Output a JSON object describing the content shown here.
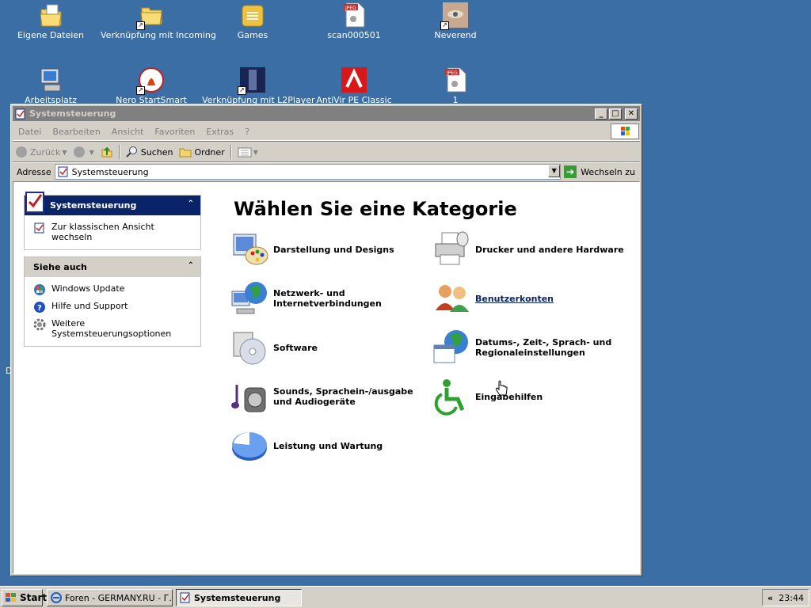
{
  "desktop": {
    "icons": [
      {
        "label": "Eigene Dateien",
        "icon": "my-documents-icon"
      },
      {
        "label": "Verknüpfung mit Incoming",
        "icon": "folder-shortcut-icon"
      },
      {
        "label": "Games",
        "icon": "games-folder-icon"
      },
      {
        "label": "scan000501",
        "icon": "jpeg-file-icon"
      },
      {
        "label": "Neverend",
        "icon": "image-shortcut-icon"
      },
      {
        "label": "Arbeitsplatz",
        "icon": "my-computer-icon"
      },
      {
        "label": "Nero StartSmart",
        "icon": "nero-icon"
      },
      {
        "label": "Verknüpfung mit L2Player",
        "icon": "l2player-icon"
      },
      {
        "label": "AntiVir PE Classic",
        "icon": "antivir-icon"
      },
      {
        "label": "1",
        "icon": "jpeg-file-icon"
      }
    ],
    "edge_text": "D"
  },
  "window": {
    "title": "Systemsteuerung",
    "menu": [
      "Datei",
      "Bearbeiten",
      "Ansicht",
      "Favoriten",
      "Extras",
      "?"
    ],
    "toolbar": {
      "back": "Zurück",
      "search": "Suchen",
      "folders": "Ordner"
    },
    "address": {
      "label": "Adresse",
      "value": "Systemsteuerung",
      "go": "Wechseln zu"
    },
    "left_panel": {
      "title": "Systemsteuerung",
      "switch_view": "Zur klassischen Ansicht wechseln",
      "see_also_title": "Siehe auch",
      "see_also": [
        "Windows Update",
        "Hilfe und Support",
        "Weitere Systemsteuerungsoptionen"
      ]
    },
    "main": {
      "heading": "Wählen Sie eine Kategorie",
      "categories": [
        "Darstellung und Designs",
        "Drucker und andere Hardware",
        "Netzwerk- und Internetverbindungen",
        "Benutzerkonten",
        "Software",
        "Datums-, Zeit-, Sprach- und Regionaleinstellungen",
        "Sounds, Sprachein-/ausgabe und Audiogeräte",
        "Eingabehilfen",
        "Leistung und Wartung"
      ]
    }
  },
  "taskbar": {
    "start": "Start",
    "tasks": [
      "Foren - GERMANY.RU - Г...",
      "Systemsteuerung"
    ],
    "clock": "23:44",
    "tray_chevron": "«"
  },
  "colors": {
    "desktop": "#3a6ea5",
    "panel_header": "#0a246a",
    "link": "#0a246a"
  }
}
